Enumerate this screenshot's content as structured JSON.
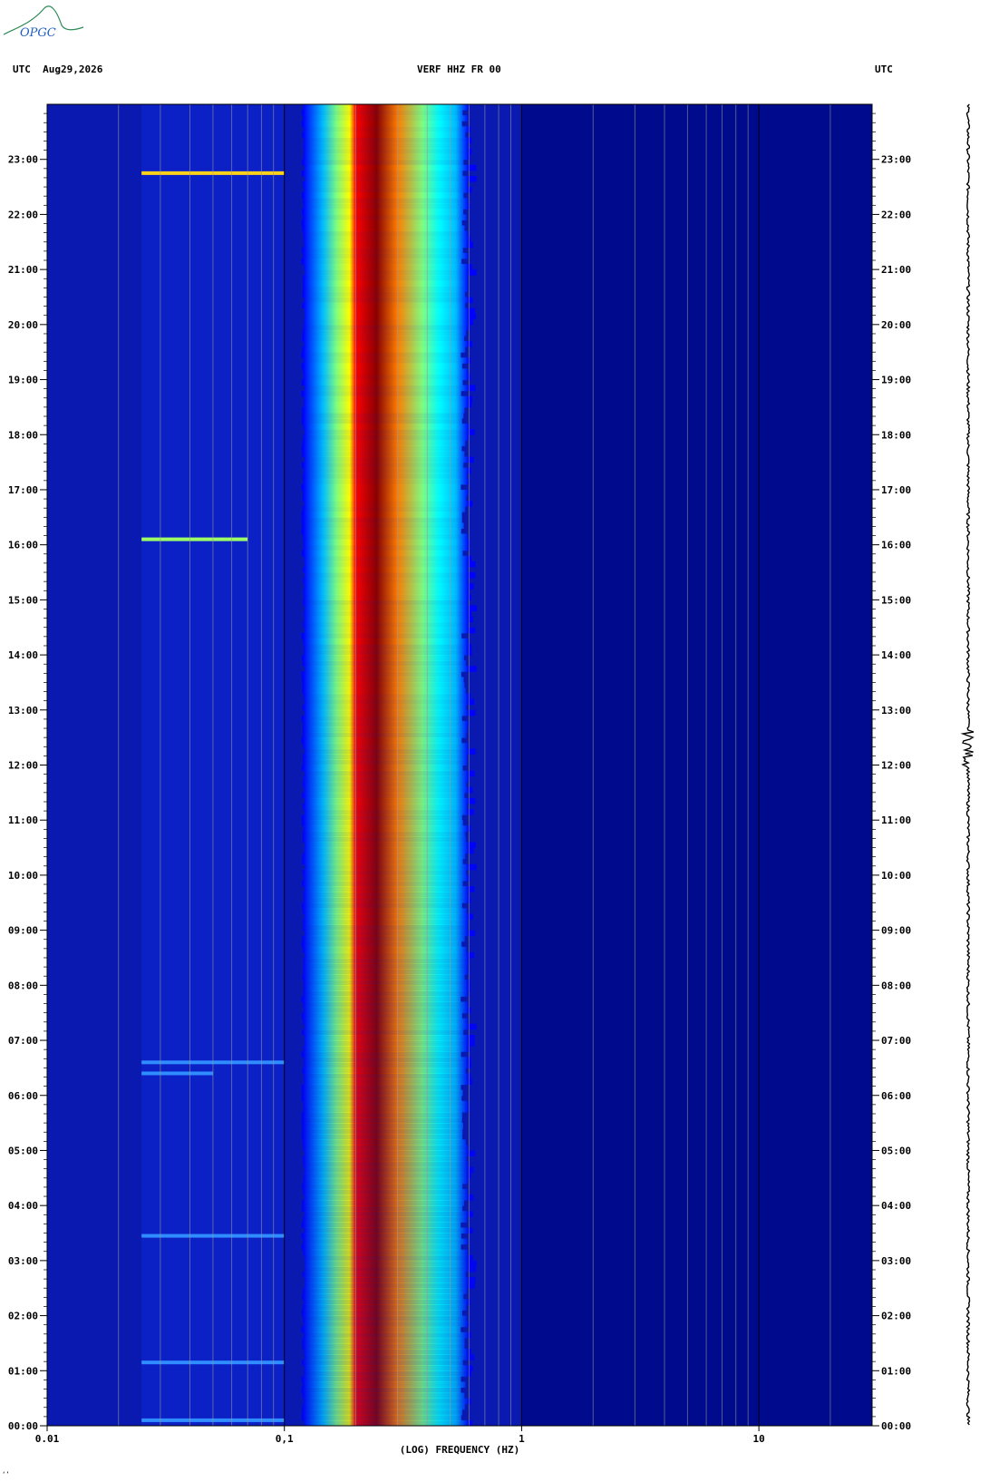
{
  "header": {
    "left": "UTC  Aug29,2026",
    "center": "VERF HHZ FR 00",
    "right": "UTC"
  },
  "logo": {
    "text": "OPGC"
  },
  "footer": {
    "mark": "‘’"
  },
  "colors": {
    "background_low": "#0a1ab0",
    "deep": "#000a8c",
    "accent_high": "#8b0000",
    "gridline": "#9a9a9a",
    "decade_line": "#000000"
  },
  "chart_data": {
    "type": "heatmap",
    "title": "VERF HHZ FR 00",
    "date": "Aug29,2026",
    "xlabel": "(LOG) FREQUENCY (HZ)",
    "ylabel": "UTC",
    "x_scale": "log",
    "xlim": [
      0.01,
      30
    ],
    "x_ticks": [
      0.01,
      0.1,
      1,
      10
    ],
    "x_tick_labels": [
      "0.01",
      "0,1",
      "1",
      "10"
    ],
    "y_range_hours": [
      0,
      24
    ],
    "y_tick_labels": [
      "00:00",
      "01:00",
      "02:00",
      "03:00",
      "04:00",
      "05:00",
      "06:00",
      "07:00",
      "08:00",
      "09:00",
      "10:00",
      "11:00",
      "12:00",
      "13:00",
      "14:00",
      "15:00",
      "16:00",
      "17:00",
      "18:00",
      "19:00",
      "20:00",
      "21:00",
      "22:00",
      "23:00"
    ],
    "dominant_band_hz": [
      0.2,
      0.3
    ],
    "band_edges_hz": [
      0.12,
      0.6
    ],
    "colormap": [
      "#000080",
      "#0000ff",
      "#00bfff",
      "#00ffff",
      "#7fff7f",
      "#ffff00",
      "#ff7f00",
      "#ff0000",
      "#8b0000"
    ],
    "transient_events": [
      {
        "hour": 22.75,
        "freq_start_hz": 0.025,
        "freq_end_hz": 0.1,
        "level": "high"
      },
      {
        "hour": 16.1,
        "freq_start_hz": 0.025,
        "freq_end_hz": 0.07,
        "level": "medium"
      },
      {
        "hour": 6.6,
        "freq_start_hz": 0.025,
        "freq_end_hz": 0.1,
        "level": "low"
      },
      {
        "hour": 6.4,
        "freq_start_hz": 0.025,
        "freq_end_hz": 0.05,
        "level": "low"
      },
      {
        "hour": 3.45,
        "freq_start_hz": 0.025,
        "freq_end_hz": 0.1,
        "level": "low"
      },
      {
        "hour": 1.15,
        "freq_start_hz": 0.025,
        "freq_end_hz": 0.1,
        "level": "low"
      },
      {
        "hour": 0.1,
        "freq_start_hz": 0.025,
        "freq_end_hz": 0.1,
        "level": "low"
      }
    ],
    "legend": "none"
  }
}
